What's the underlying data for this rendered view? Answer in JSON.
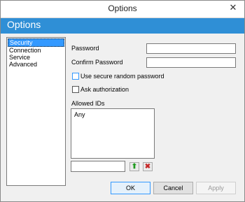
{
  "window": {
    "title": "Options",
    "close_glyph": "✕"
  },
  "banner": {
    "title": "Options"
  },
  "sidebar": {
    "items": [
      {
        "label": "Security",
        "selected": true
      },
      {
        "label": "Connection",
        "selected": false
      },
      {
        "label": "Service",
        "selected": false
      },
      {
        "label": "Advanced",
        "selected": false
      }
    ]
  },
  "form": {
    "password_label": "Password",
    "password_value": "",
    "confirm_label": "Confirm Password",
    "confirm_value": "",
    "secure_random_label": "Use secure random password",
    "ask_auth_label": "Ask authorization",
    "allowed_ids_label": "Allowed IDs",
    "allowed_ids": [
      "Any"
    ],
    "new_id_value": ""
  },
  "mini_buttons": {
    "add_icon": "arrow-up-icon",
    "add_glyph": "⬆",
    "remove_icon": "delete-icon",
    "remove_glyph": "✖"
  },
  "buttons": {
    "ok": "OK",
    "cancel": "Cancel",
    "apply": "Apply"
  },
  "colors": {
    "banner": "#2f8fd6",
    "selection": "#3399ff"
  }
}
